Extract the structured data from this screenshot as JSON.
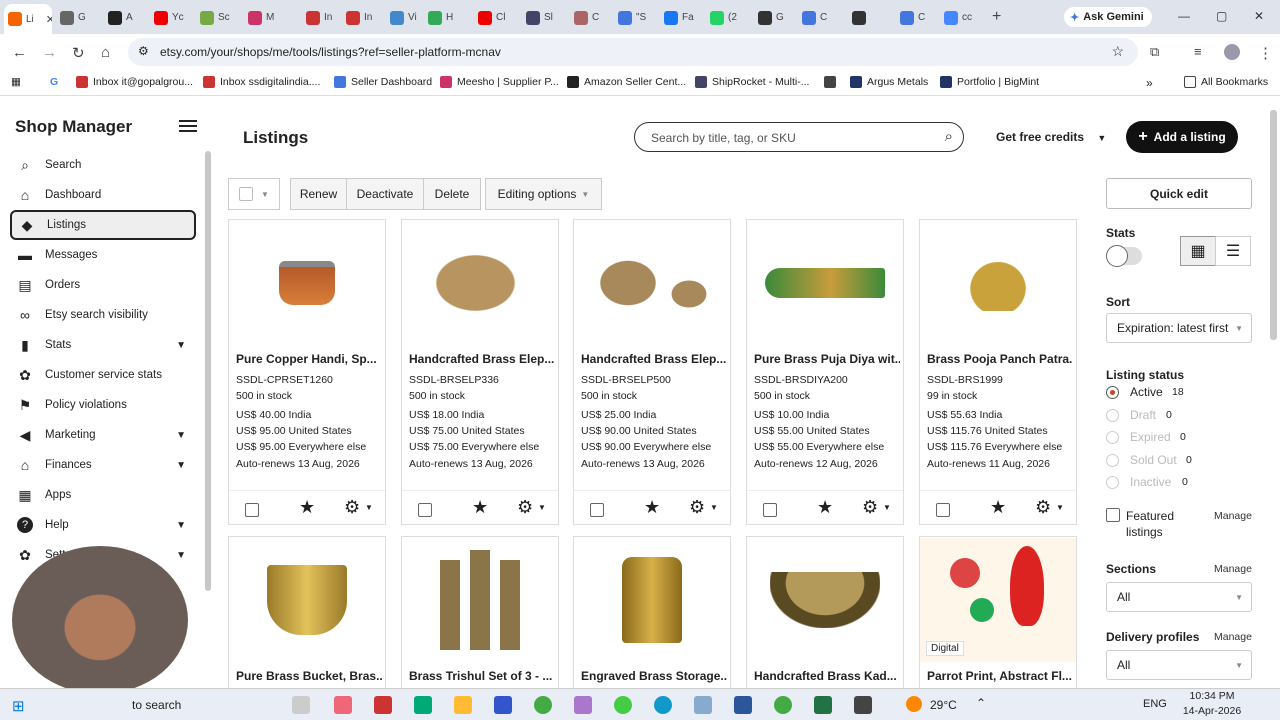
{
  "browser": {
    "tabs": [
      {
        "label": "Li",
        "color": "#f56400"
      },
      {
        "label": "G",
        "color": "#666"
      },
      {
        "label": "A",
        "color": "#222"
      },
      {
        "label": "Yc",
        "color": "#e00"
      },
      {
        "label": "Sc",
        "color": "#7a4"
      },
      {
        "label": "M",
        "color": "#c36"
      },
      {
        "label": "In",
        "color": "#c33"
      },
      {
        "label": "In",
        "color": "#c33"
      },
      {
        "label": "Vi",
        "color": "#48c"
      },
      {
        "label": "H",
        "color": "#3a5"
      },
      {
        "label": "Cl",
        "color": "#e00"
      },
      {
        "label": "Sl",
        "color": "#446"
      },
      {
        "label": "C",
        "color": "#a66"
      },
      {
        "label": "\"S",
        "color": "#47d"
      },
      {
        "label": "Fa",
        "color": "#1877f2"
      },
      {
        "label": "(2",
        "color": "#25d366"
      },
      {
        "label": "G",
        "color": "#333"
      },
      {
        "label": "C",
        "color": "#47d"
      },
      {
        "label": "",
        "color": "#333"
      },
      {
        "label": "C",
        "color": "#47d"
      },
      {
        "label": "cc",
        "color": "#48f"
      }
    ],
    "gemini_label": "Ask Gemini",
    "url": "etsy.com/your/shops/me/tools/listings?ref=seller-platform-mcnav",
    "bookmarks": [
      {
        "label": "Inbox it@gopalgrou...",
        "color": "#c33"
      },
      {
        "label": "Inbox ssdigitalindia....",
        "color": "#c33"
      },
      {
        "label": "Seller Dashboard",
        "color": "#47d"
      },
      {
        "label": "Meesho | Supplier P...",
        "color": "#c36"
      },
      {
        "label": "Amazon Seller Cent...",
        "color": "#222"
      },
      {
        "label": "ShipRocket - Multi-...",
        "color": "#446"
      },
      {
        "label": "",
        "color": "#444"
      },
      {
        "label": "Argus Metals",
        "color": "#236"
      },
      {
        "label": "Portfolio | BigMint",
        "color": "#236"
      }
    ],
    "all_bookmarks": "All Bookmarks"
  },
  "sidebar": {
    "title": "Shop Manager",
    "items": [
      {
        "label": "Search",
        "icon": "search-icon"
      },
      {
        "label": "Dashboard",
        "icon": "home-icon"
      },
      {
        "label": "Listings",
        "icon": "tag-icon"
      },
      {
        "label": "Messages",
        "icon": "chat-icon"
      },
      {
        "label": "Orders",
        "icon": "clipboard-icon"
      },
      {
        "label": "Etsy search visibility",
        "icon": "binoculars-icon"
      },
      {
        "label": "Stats",
        "icon": "bar-chart-icon"
      },
      {
        "label": "Customer service stats",
        "icon": "gear-icon"
      },
      {
        "label": "Policy violations",
        "icon": "flag-icon"
      },
      {
        "label": "Marketing",
        "icon": "megaphone-icon"
      },
      {
        "label": "Finances",
        "icon": "bank-icon"
      },
      {
        "label": "Apps",
        "icon": "grid-icon"
      },
      {
        "label": "Help",
        "icon": "help-icon"
      },
      {
        "label": "Sett",
        "icon": "settings-icon"
      }
    ]
  },
  "main": {
    "title": "Listings",
    "search_placeholder": "Search by title, tag, or SKU",
    "free_credits": "Get free credits",
    "add_listing": "Add a listing",
    "toolbar": {
      "renew": "Renew",
      "deactivate": "Deactivate",
      "delete": "Delete",
      "editing": "Editing options"
    }
  },
  "listings": [
    {
      "title": "Pure Copper Handi, Sp...",
      "sku": "SSDL-CPRSET1260",
      "stock": "500 in stock",
      "p1": "US$ 40.00 India",
      "p2": "US$ 95.00 United States",
      "p3": "US$ 95.00 Everywhere else",
      "renew": "Auto-renews 13 Aug, 2026"
    },
    {
      "title": "Handcrafted Brass Elep...",
      "sku": "SSDL-BRSELP336",
      "stock": "500 in stock",
      "p1": "US$ 18.00 India",
      "p2": "US$ 75.00 United States",
      "p3": "US$ 75.00 Everywhere else",
      "renew": "Auto-renews 13 Aug, 2026"
    },
    {
      "title": "Handcrafted Brass Elep...",
      "sku": "SSDL-BRSELP500",
      "stock": "500 in stock",
      "p1": "US$ 25.00 India",
      "p2": "US$ 90.00 United States",
      "p3": "US$ 90.00 Everywhere else",
      "renew": "Auto-renews 13 Aug, 2026"
    },
    {
      "title": "Pure Brass Puja Diya wit...",
      "sku": "SSDL-BRSDIYA200",
      "stock": "500 in stock",
      "p1": "US$ 10.00 India",
      "p2": "US$ 55.00 United States",
      "p3": "US$ 55.00 Everywhere else",
      "renew": "Auto-renews 12 Aug, 2026"
    },
    {
      "title": "Brass Pooja Panch Patra...",
      "sku": "SSDL-BRS1999",
      "stock": "99 in stock",
      "p1": "US$ 55.63 India",
      "p2": "US$ 115.76 United States",
      "p3": "US$ 115.76 Everywhere else",
      "renew": "Auto-renews 11 Aug, 2026"
    }
  ],
  "listings_row2": [
    {
      "title": "Pure Brass Bucket, Bras..."
    },
    {
      "title": "Brass Trishul Set of 3 - ..."
    },
    {
      "title": "Engraved Brass Storage..."
    },
    {
      "title": "Handcrafted Brass Kad..."
    },
    {
      "title": "Parrot Print, Abstract Fl...",
      "badge": "Digital"
    }
  ],
  "rpanel": {
    "quick_edit": "Quick edit",
    "stats": "Stats",
    "sort": "Sort",
    "sort_value": "Expiration: latest first",
    "status_title": "Listing status",
    "statuses": [
      {
        "label": "Active",
        "count": "18"
      },
      {
        "label": "Draft",
        "count": "0"
      },
      {
        "label": "Expired",
        "count": "0"
      },
      {
        "label": "Sold Out",
        "count": "0"
      },
      {
        "label": "Inactive",
        "count": "0"
      }
    ],
    "featured": "Featured listings",
    "manage": "Manage",
    "sections": "Sections",
    "sections_value": "All",
    "delivery": "Delivery profiles",
    "delivery_value": "All"
  },
  "taskbar": {
    "search": "to search",
    "weather": "29°C",
    "lang": "ENG",
    "time": "10:34 PM",
    "date": "14-Apr-2026"
  },
  "colors": {
    "accent": "#f56400",
    "primary_btn": "#111111",
    "active_radio": "#d04020"
  }
}
